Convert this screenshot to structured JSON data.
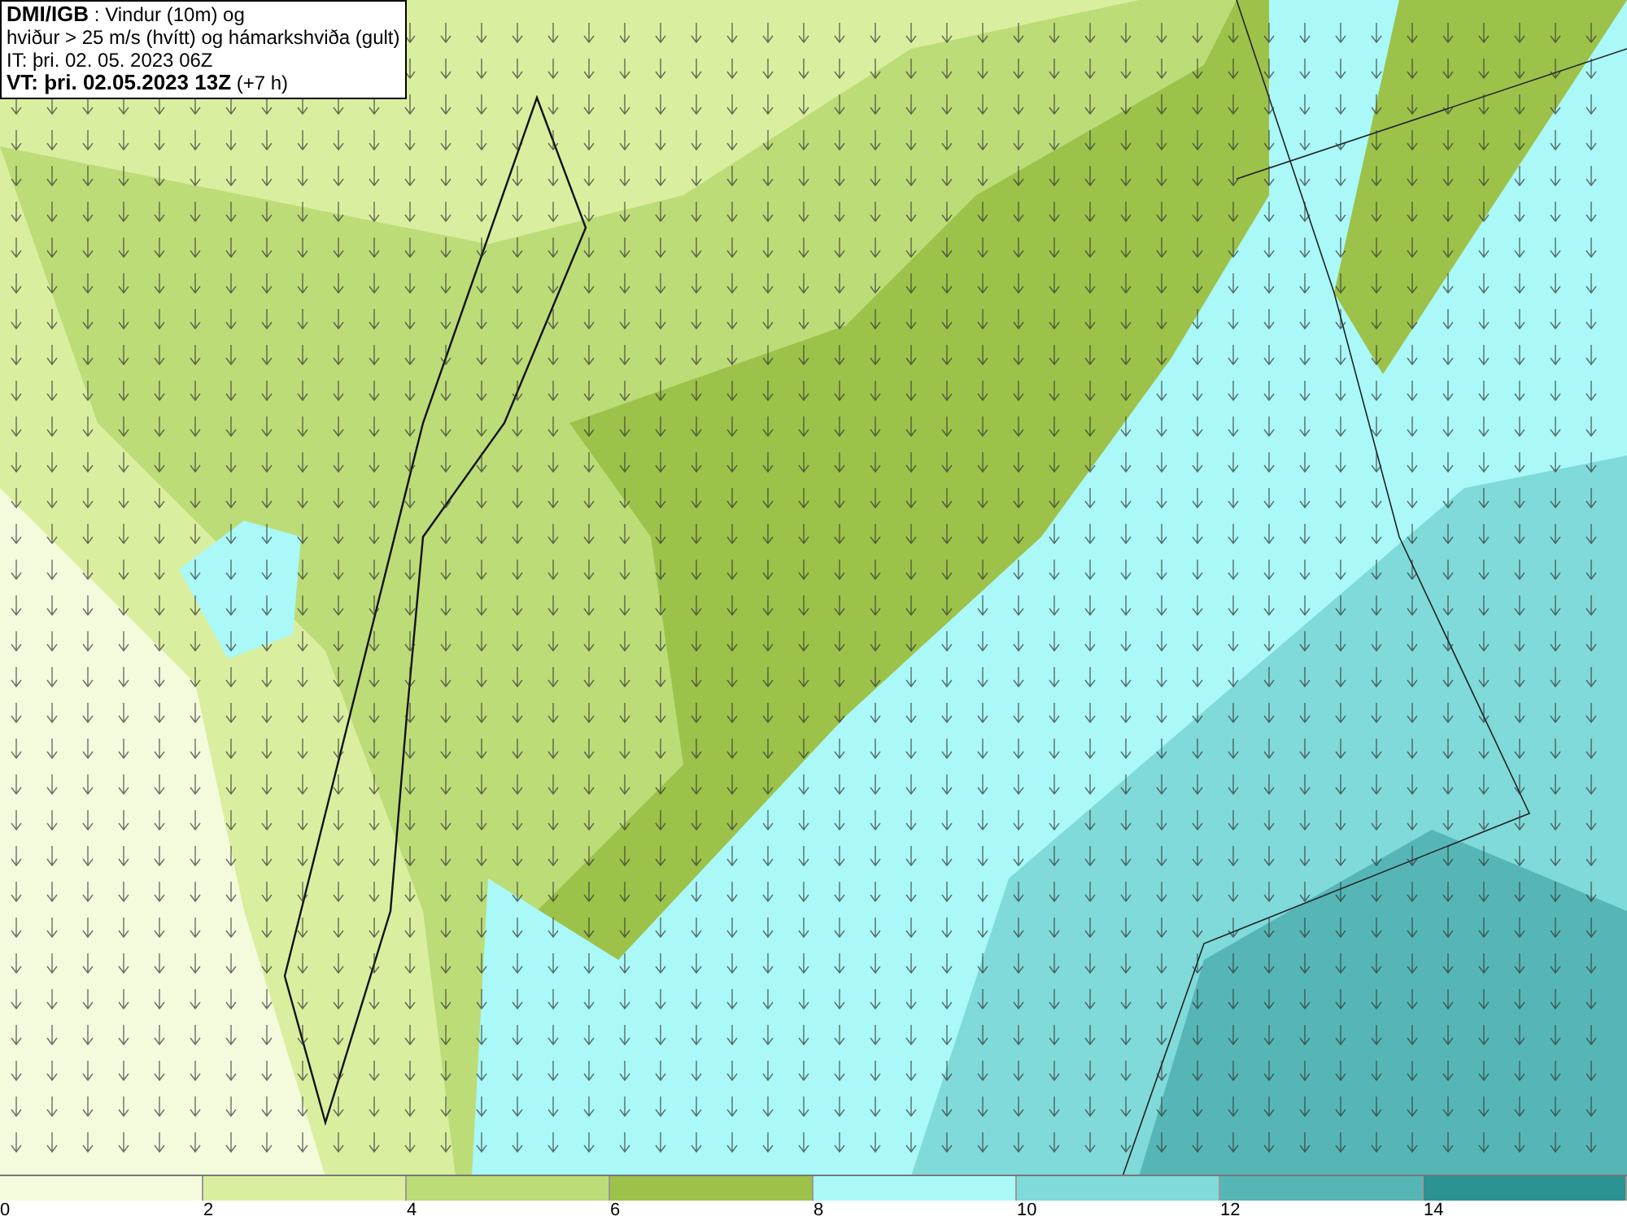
{
  "title_box": {
    "lines": [
      "**DMI/IGB** : Vindur (10m) og",
      "hviður > 25 m/s (hvítt) og hámarkshviða (gult)",
      "IT: þri. 02. 05. 2023 06Z",
      "**VT: þri. 02.05.2023 13Z** (+7 h)"
    ]
  },
  "legend": [
    {
      "color": "#f4fadc",
      "label": "0"
    },
    {
      "color": "#d9ef9f",
      "label": "2"
    },
    {
      "color": "#bcdc78",
      "label": "4"
    },
    {
      "color": "#9cc24a",
      "label": "6"
    },
    {
      "color": "#aaf8f8",
      "label": "8"
    },
    {
      "color": "#80dada",
      "label": "10"
    },
    {
      "color": "#56b6b6",
      "label": "12"
    },
    {
      "color": "#2b9292",
      "label": "14"
    }
  ]
}
